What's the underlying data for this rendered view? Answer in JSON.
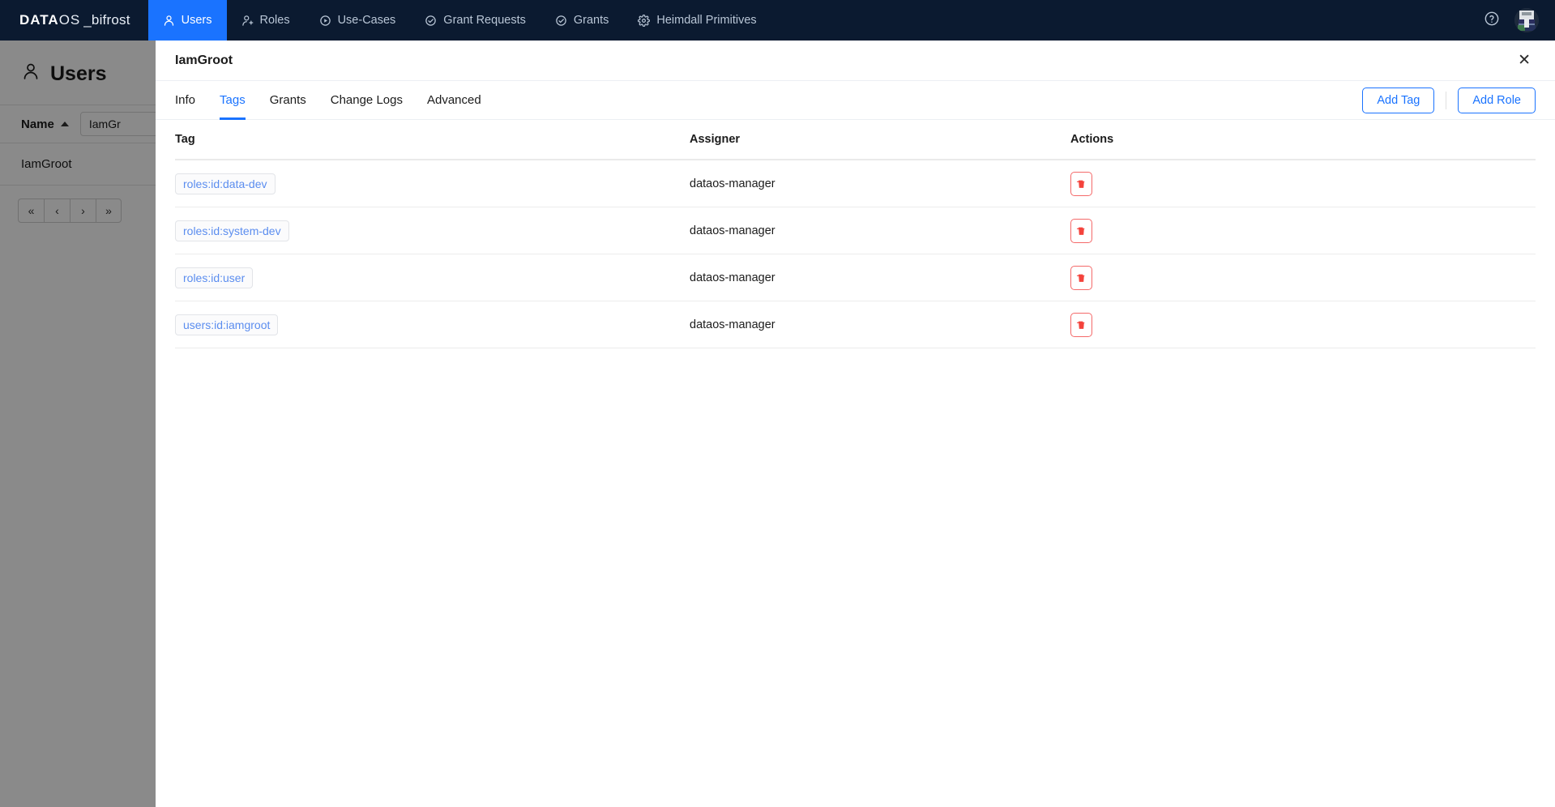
{
  "topnav": {
    "brand": {
      "data": "DATA",
      "os": "OS",
      "sub": "_bifrost"
    },
    "items": [
      {
        "label": "Users",
        "icon": "user-icon",
        "active": true
      },
      {
        "label": "Roles",
        "icon": "user-plus-icon",
        "active": false
      },
      {
        "label": "Use-Cases",
        "icon": "play-circle-icon",
        "active": false
      },
      {
        "label": "Grant Requests",
        "icon": "check-circle-icon",
        "active": false
      },
      {
        "label": "Grants",
        "icon": "check-circle-icon",
        "active": false
      },
      {
        "label": "Heimdall Primitives",
        "icon": "gear-icon",
        "active": false
      }
    ],
    "help_icon": "help-circle-icon",
    "avatar_icon": "avatar"
  },
  "background_page": {
    "title": "Users",
    "title_icon": "user-icon",
    "column_header": "Name",
    "sort_direction": "asc",
    "filter_value": "IamGr",
    "filter_placeholder": "",
    "rows": [
      "IamGroot"
    ],
    "pagination": [
      {
        "label": "«",
        "name": "first-page-button"
      },
      {
        "label": "‹",
        "name": "prev-page-button"
      },
      {
        "label": "›",
        "name": "next-page-button"
      },
      {
        "label": "»",
        "name": "last-page-button"
      }
    ]
  },
  "modal": {
    "title": "IamGroot",
    "close_label": "✕",
    "tabs": [
      {
        "label": "Info",
        "active": false
      },
      {
        "label": "Tags",
        "active": true
      },
      {
        "label": "Grants",
        "active": false
      },
      {
        "label": "Change Logs",
        "active": false
      },
      {
        "label": "Advanced",
        "active": false
      }
    ],
    "actions": {
      "add_tag_label": "Add Tag",
      "add_role_label": "Add Role"
    },
    "table": {
      "columns": [
        "Tag",
        "Assigner",
        "Actions"
      ],
      "rows": [
        {
          "tag": "roles:id:data-dev",
          "assigner": "dataos-manager",
          "action_icon": "trash-icon"
        },
        {
          "tag": "roles:id:system-dev",
          "assigner": "dataos-manager",
          "action_icon": "trash-icon"
        },
        {
          "tag": "roles:id:user",
          "assigner": "dataos-manager",
          "action_icon": "trash-icon"
        },
        {
          "tag": "users:id:iamgroot",
          "assigner": "dataos-manager",
          "action_icon": "trash-icon"
        }
      ]
    }
  },
  "colors": {
    "navbar_bg": "#0b1a30",
    "accent_blue": "#1a73ff",
    "tag_text": "#5b8def",
    "danger_red": "#f46a6a",
    "overlay": "rgba(0,0,0,0.46)"
  }
}
